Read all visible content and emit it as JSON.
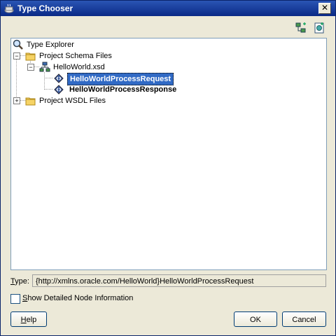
{
  "window": {
    "title": "Type Chooser",
    "close_glyph": "✕"
  },
  "toolbar": {
    "icons": [
      "tree-view-icon",
      "new-schema-icon"
    ]
  },
  "tree": {
    "root": {
      "label": "Type Explorer",
      "icon": "search-icon"
    },
    "items": [
      {
        "label": "Project Schema Files",
        "icon": "folder-icon",
        "expanded": true
      },
      {
        "label": "HelloWorld.xsd",
        "icon": "schema-icon",
        "expanded": true
      },
      {
        "label": "HelloWorldProcessRequest",
        "icon": "element-icon",
        "selected": true
      },
      {
        "label": "HelloWorldProcessResponse",
        "icon": "element-icon",
        "selected": false
      },
      {
        "label": "Project WSDL Files",
        "icon": "folder-icon",
        "expanded": false
      }
    ]
  },
  "type_field": {
    "label": "Type:",
    "label_mnemonic": "T",
    "label_rest": "ype:",
    "value": "{http://xmlns.oracle.com/HelloWorld}HelloWorldProcessRequest"
  },
  "options": {
    "show_detailed_mnemonic": "S",
    "show_detailed_rest": "how Detailed Node Information",
    "checked": false
  },
  "buttons": {
    "help_mnemonic": "H",
    "help_rest": "elp",
    "ok": "OK",
    "cancel": "Cancel"
  },
  "colors": {
    "title_bar": "#0a2a86",
    "selection": "#316ac5",
    "dialog_bg": "#ece9d8"
  }
}
